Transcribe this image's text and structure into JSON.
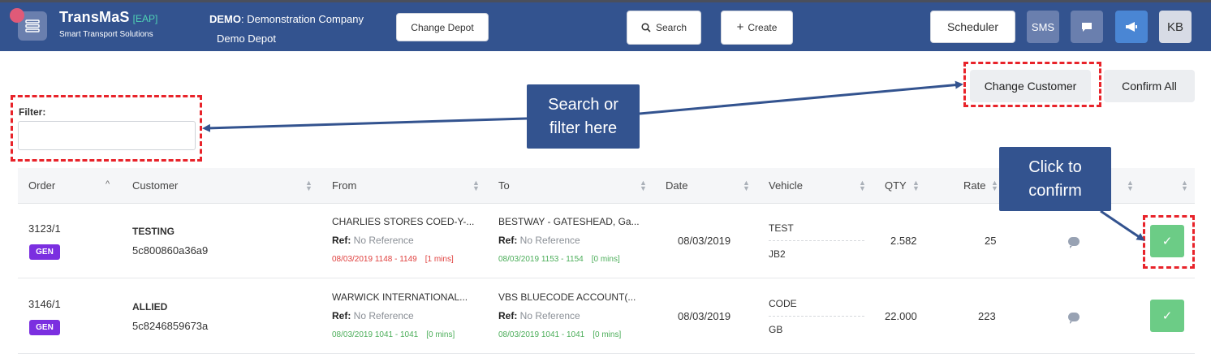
{
  "header": {
    "brand": "TransMaS",
    "brand_tag": "[EAP]",
    "brand_sub": "Smart Transport Solutions",
    "company_prefix": "DEMO",
    "company_name": ": Demonstration Company",
    "depot": "Demo Depot",
    "change_depot": "Change Depot",
    "search": "Search",
    "create": "Create",
    "scheduler": "Scheduler",
    "sms": "SMS",
    "avatar": "KB"
  },
  "filter": {
    "label": "Filter:",
    "value": "",
    "placeholder": ""
  },
  "actions": {
    "change_customer": "Change Customer",
    "confirm_all": "Confirm All"
  },
  "callouts": {
    "search_line1": "Search or",
    "search_line2": "filter here",
    "confirm_line1": "Click to",
    "confirm_line2": "confirm"
  },
  "columns": [
    "Order",
    "Customer",
    "From",
    "To",
    "Date",
    "Vehicle",
    "QTY",
    "Rate"
  ],
  "rows": [
    {
      "order": "3123/1",
      "badge": "GEN",
      "customer": "TESTING",
      "customer_id": "5c800860a36a9",
      "from": "CHARLIES STORES COED-Y-...",
      "from_ref_label": "Ref:",
      "from_ref": " No Reference",
      "from_time": "08/03/2019 1148 - 1149",
      "from_dur": "[1 mins]",
      "to": "BESTWAY - GATESHEAD, Ga...",
      "to_ref_label": "Ref:",
      "to_ref": " No Reference",
      "to_time": "08/03/2019 1153 - 1154",
      "to_dur": "[0 mins]",
      "date": "08/03/2019",
      "vehicle_top": "TEST",
      "vehicle_bottom": "JB2",
      "qty": "2.582",
      "rate": "25"
    },
    {
      "order": "3146/1",
      "badge": "GEN",
      "customer": "ALLIED",
      "customer_id": "5c8246859673a",
      "from": "WARWICK INTERNATIONAL...",
      "from_ref_label": "Ref:",
      "from_ref": " No Reference",
      "from_time": "08/03/2019 1041 - 1041",
      "from_dur": "[0 mins]",
      "to": "VBS BLUECODE ACCOUNT(...",
      "to_ref_label": "Ref:",
      "to_ref": " No Reference",
      "to_time": "08/03/2019 1041 - 1041",
      "to_dur": "[0 mins]",
      "date": "08/03/2019",
      "vehicle_top": "CODE",
      "vehicle_bottom": "GB",
      "qty": "22.000",
      "rate": "223"
    }
  ],
  "colors": {
    "navbar": "#33538f",
    "badge": "#7b2fe0",
    "confirm": "#6ccc86",
    "highlight": "#e8232a"
  }
}
